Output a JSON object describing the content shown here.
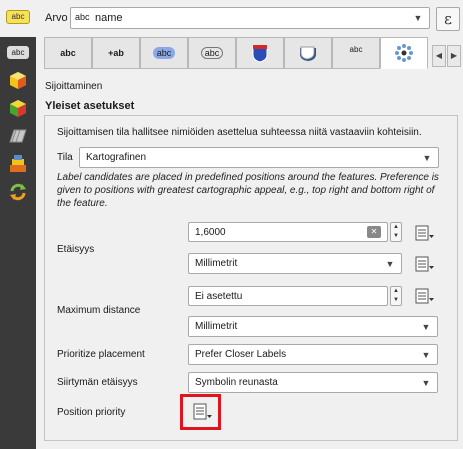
{
  "value_row": {
    "label": "Arvo",
    "field_tag": "abc",
    "field_value": "name",
    "expression_symbol": "ε"
  },
  "tabs": [
    {
      "name": "tab-text",
      "glyph": "abc"
    },
    {
      "name": "tab-formatting",
      "glyph": "+ab"
    },
    {
      "name": "tab-buffer",
      "glyph": "abc"
    },
    {
      "name": "tab-mask",
      "glyph": "abc"
    },
    {
      "name": "tab-background",
      "glyph": ""
    },
    {
      "name": "tab-shadow",
      "glyph": ""
    },
    {
      "name": "tab-callouts",
      "glyph": "abc"
    },
    {
      "name": "tab-placement",
      "glyph": ""
    }
  ],
  "section": {
    "title": "Sijoittaminen",
    "group_title": "Yleiset asetukset",
    "mode_description": "Sijoittamisen tila hallitsee nimiöiden asettelua suhteessa niitä vastaaviin kohteisiin.",
    "mode_label": "Tila",
    "mode_value": "Kartografinen",
    "help_text": "Label candidates are placed in predefined positions around the features. Preference is given to positions with greatest cartographic appeal, e.g., top right and bottom right of the feature.",
    "distance_label": "Etäisyys",
    "distance_value": "1,6000",
    "distance_unit": "Millimetrit",
    "max_distance_label": "Maximum distance",
    "max_distance_value": "Ei asetettu",
    "max_distance_unit": "Millimetrit",
    "prioritize_label": "Prioritize placement",
    "prioritize_value": "Prefer Closer Labels",
    "offset_label": "Siirtymän etäisyys",
    "offset_value": "Symbolin reunasta",
    "position_priority_label": "Position priority"
  },
  "colors": {
    "highlight": "#e0141e",
    "sidebar": "#3a3a3a",
    "label_yellow": "#f7e05a"
  }
}
